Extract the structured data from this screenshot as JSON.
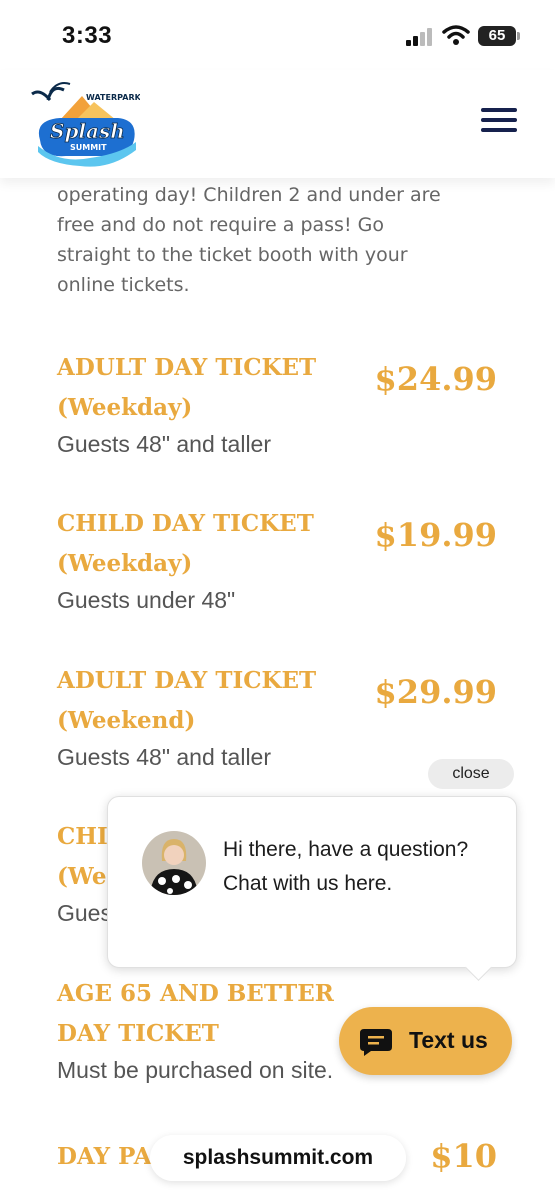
{
  "status_bar": {
    "time": "3:33",
    "battery": "65"
  },
  "header": {
    "logo_top": "WATERPARK",
    "logo_main": "Splash",
    "logo_bottom": "SUMMIT"
  },
  "intro_lines": [
    "operating day! Children 2 and under are",
    "free and do not require a pass! Go",
    "straight to the ticket booth with your",
    "online tickets."
  ],
  "tickets": [
    {
      "title_1": "ADULT DAY TICKET",
      "title_2": "(Weekday)",
      "subtitle": "Guests 48\" and taller",
      "price": "$24.99"
    },
    {
      "title_1": "CHILD DAY TICKET",
      "title_2": "(Weekday)",
      "subtitle": "Guests under 48\"",
      "price": "$19.99"
    },
    {
      "title_1": "ADULT DAY TICKET",
      "title_2": "(Weekend)",
      "subtitle": "Guests 48\" and taller",
      "price": "$29.99"
    },
    {
      "title_1": "CHI",
      "title_2": "(We",
      "subtitle": "Gues"
    },
    {
      "title_1": "AGE 65 AND BETTER",
      "title_2": "DAY TICKET",
      "subtitle": "Must be purchased on site."
    },
    {
      "title_1": "DAY PA",
      "price": "$10"
    }
  ],
  "chat": {
    "close_label": "close",
    "message": "Hi there, have a question? Chat with us here.",
    "button_label": "Text us"
  },
  "browser": {
    "url": "splashsummit.com"
  },
  "colors": {
    "accent": "#e9a93f",
    "navy": "#16214d",
    "chat_button": "#edb24d"
  }
}
